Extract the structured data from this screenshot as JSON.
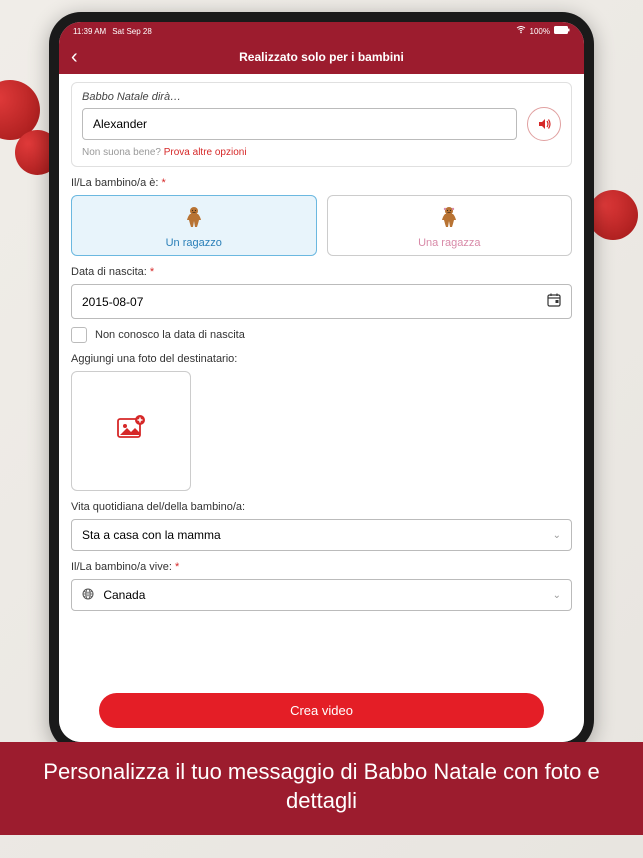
{
  "status": {
    "time": "11:39 AM",
    "date": "Sat Sep 28",
    "battery": "100%"
  },
  "header": {
    "title": "Realizzato solo per i bambini"
  },
  "santa_says": {
    "label": "Babbo Natale dirà…",
    "value": "Alexander",
    "hint_prefix": "Non suona bene? ",
    "hint_link": "Prova altre opzioni"
  },
  "gender": {
    "label": "Il/La bambino/a è: ",
    "boy": "Un ragazzo",
    "girl": "Una ragazza"
  },
  "birth": {
    "label": "Data di nascita: ",
    "value": "2015-08-07",
    "unknown_label": "Non conosco la data di nascita"
  },
  "photo": {
    "label": "Aggiungi una foto del destinatario:"
  },
  "daily_life": {
    "label": "Vita quotidiana del/della bambino/a:",
    "value": "Sta a casa con la mamma"
  },
  "lives": {
    "label": "Il/La bambino/a vive: ",
    "value": "Canada"
  },
  "cta": "Crea video",
  "caption": "Personalizza il tuo messaggio di Babbo Natale con foto e dettagli",
  "asterisk": "*"
}
